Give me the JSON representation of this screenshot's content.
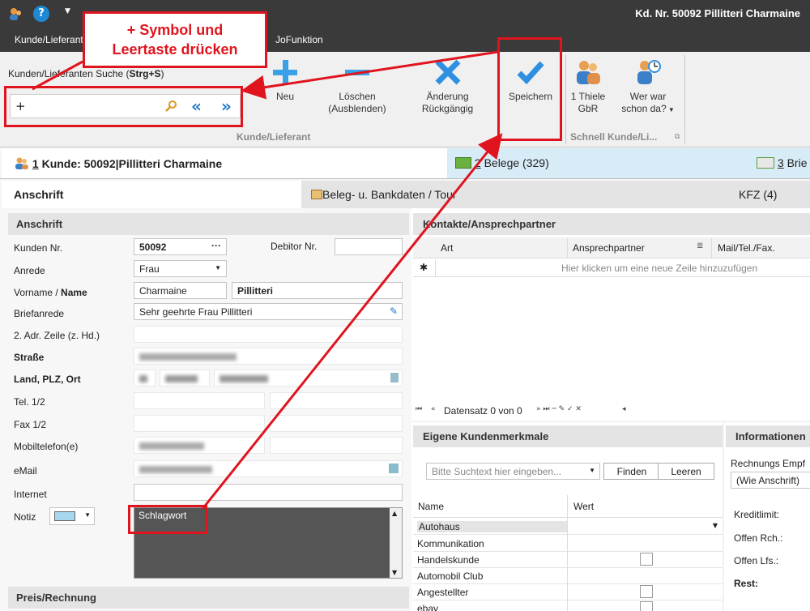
{
  "window": {
    "title": "Kd. Nr. 50092 Pillitteri Charmaine"
  },
  "menu": {
    "items": [
      "Kunde/Lieferant",
      "JoFunktion"
    ]
  },
  "callout": {
    "line1": "+ Symbol und",
    "line2": "Leertaste drücken"
  },
  "search": {
    "label_prefix": "Kunden/Lieferanten Suche (",
    "label_shortcut": "Strg+S",
    "label_suffix": ")",
    "value": "+"
  },
  "ribbon": {
    "new": "Neu",
    "delete_1": "Löschen",
    "delete_2": "(Ausblenden)",
    "undo_1": "Änderung",
    "undo_2": "Rückgängig",
    "save": "Speichern",
    "contact_1": "1 Thiele",
    "contact_2": "GbR",
    "who_1": "Wer war",
    "who_2": "schon da?",
    "group_customer": "Kunde/Lieferant",
    "group_quick": "Schnell Kunde/Li..."
  },
  "tabs_top": [
    {
      "num": "1",
      "label": " Kunde: 50092|Pillitteri Charmaine"
    },
    {
      "num": "2",
      "label": " Belege (329)"
    },
    {
      "num": "3",
      "label": " Brie"
    }
  ],
  "tabs_sub": [
    "Anschrift",
    "Beleg- u. Bankdaten / Tour",
    "KFZ (4)"
  ],
  "address": {
    "header": "Anschrift",
    "customer_no_label": "Kunden Nr.",
    "customer_no": "50092",
    "debitor_label": "Debitor Nr.",
    "salutation_label": "Anrede",
    "salutation": "Frau",
    "name_label_first": "Vorname / ",
    "name_label_last": "Name",
    "first_name": "Charmaine",
    "last_name": "Pillitteri",
    "letter_label": "Briefanrede",
    "letter": "Sehr geehrte Frau Pillitteri",
    "addr2_label": "2. Adr. Zeile (z. Hd.)",
    "street_label": "Straße",
    "country_label": "Land, PLZ, Ort",
    "tel_label": "Tel. 1/2",
    "fax_label": "Fax 1/2",
    "mobile_label": "Mobiltelefon(e)",
    "email_label": "eMail",
    "internet_label": "Internet",
    "note_label": "Notiz",
    "note": "Schlagwort"
  },
  "price": {
    "header": "Preis/Rechnung"
  },
  "contacts": {
    "header": "Kontakte/Ansprechpartner",
    "columns": [
      "Art",
      "Ansprechpartner",
      "Mail/Tel./Fax."
    ],
    "new_row": "Hier klicken um eine neue Zeile hinzuzufügen",
    "record": "Datensatz 0 von 0"
  },
  "features": {
    "header": "Eigene Kundenmerkmale",
    "search_placeholder": "Bitte Suchtext hier eingeben...",
    "find": "Finden",
    "clear": "Leeren",
    "col_name": "Name",
    "col_value": "Wert",
    "rows": [
      "Autohaus",
      "Kommunikation",
      "Handelskunde",
      "Automobil Club",
      "Angestellter",
      "ebay"
    ]
  },
  "info": {
    "header": "Informationen",
    "invoice_label": "Rechnungs Empf",
    "invoice_value": "(Wie Anschrift)",
    "credit": "Kreditlimit:",
    "open_inv": "Offen Rch.:",
    "open_dn": "Offen Lfs.:",
    "rest": "Rest:"
  },
  "colors": {
    "accent": "#1e88d4",
    "annotation": "#e0141e",
    "titlebar": "#3a3a3a"
  }
}
